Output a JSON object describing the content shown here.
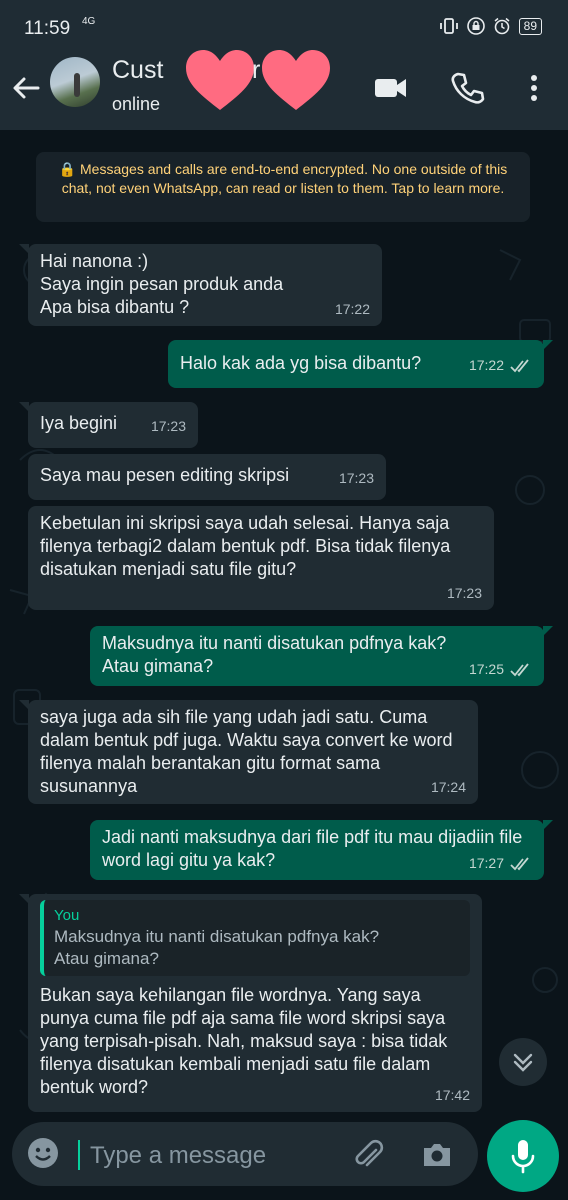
{
  "status_bar": {
    "time": "11:59",
    "network": "4G",
    "battery": "89"
  },
  "header": {
    "name": "Cust",
    "name_tail": "r",
    "presence": "online"
  },
  "system_message": "🔒 Messages and calls are end-to-end encrypted. No one outside of this chat, not even WhatsApp, can read or listen to them. Tap to learn more.",
  "messages": [
    {
      "dir": "in",
      "text": "Hai nanona :)\nSaya ingin pesan produk anda\nApa bisa dibantu ?",
      "time": "17:22"
    },
    {
      "dir": "out",
      "text": "Halo kak ada yg bisa dibantu?",
      "time": "17:22"
    },
    {
      "dir": "in",
      "text": "Iya begini",
      "time": "17:23"
    },
    {
      "dir": "in",
      "text": "Saya mau pesen editing skripsi",
      "time": "17:23"
    },
    {
      "dir": "in",
      "text": "Kebetulan ini skripsi saya udah selesai. Hanya saja filenya terbagi2 dalam bentuk pdf. Bisa tidak filenya disatukan menjadi satu file gitu?",
      "time": "17:23"
    },
    {
      "dir": "out",
      "text": "Maksudnya itu nanti disatukan pdfnya kak?\nAtau gimana?",
      "time": "17:25"
    },
    {
      "dir": "in",
      "text": "saya juga ada sih file yang udah jadi satu. Cuma dalam bentuk pdf juga. Waktu saya convert ke word filenya malah berantakan gitu format sama susunannya",
      "time": "17:24"
    },
    {
      "dir": "out",
      "text": "Jadi nanti maksudnya dari file pdf itu mau dijadiin file word lagi gitu ya kak?",
      "time": "17:27"
    },
    {
      "dir": "in",
      "quote_name": "You",
      "quote_text": "Maksudnya itu nanti disatukan pdfnya kak?\nAtau gimana?",
      "text": "Bukan saya kehilangan file wordnya. Yang saya punya cuma file pdf aja sama file word skripsi saya yang terpisah-pisah. Nah, maksud saya : bisa tidak filenya disatukan kembali menjadi satu file dalam bentuk word?",
      "time": "17:42"
    }
  ],
  "input": {
    "placeholder": "Type a message"
  },
  "colors": {
    "background": "#0b141a",
    "header": "#1f2c34",
    "incoming": "#202c33",
    "outgoing": "#005c4b",
    "accent": "#00a884",
    "system_text": "#ffd279",
    "heart_sticker": "#ff6b81"
  },
  "icons": [
    "back-arrow-icon",
    "video-call-icon",
    "voice-call-icon",
    "more-options-icon",
    "emoji-icon",
    "attach-icon",
    "camera-icon",
    "mic-icon",
    "scroll-down-icon",
    "double-check-icon",
    "lock-icon"
  ]
}
